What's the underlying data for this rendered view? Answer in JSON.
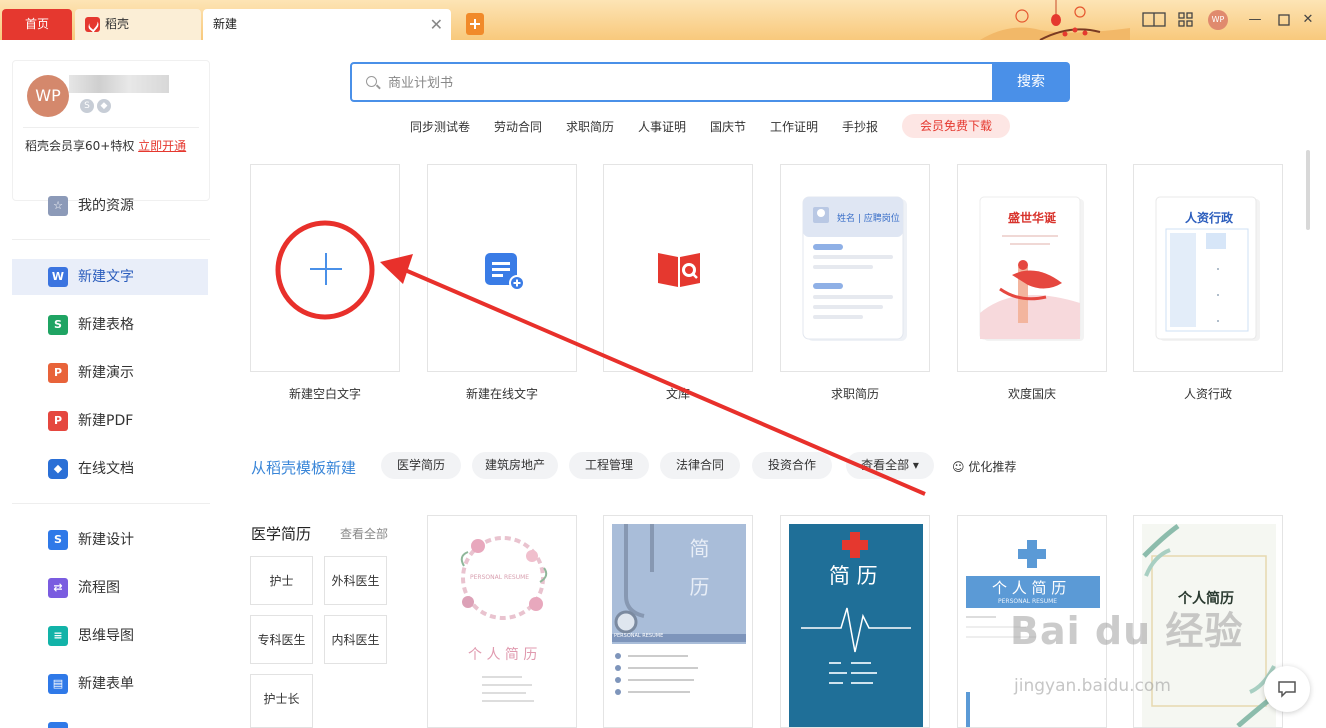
{
  "tabs": {
    "home": "首页",
    "daoke": "稻壳",
    "new": "新建"
  },
  "window": {
    "avatar_text": "WP"
  },
  "profile": {
    "avatar_text": "WP",
    "vip_text": "稻壳会员享60+特权",
    "vip_link": "立即开通"
  },
  "sidebar": {
    "resources": "我的资源",
    "items": [
      "新建文字",
      "新建表格",
      "新建演示",
      "新建PDF",
      "在线文档"
    ],
    "items2": [
      "新建设计",
      "流程图",
      "思维导图",
      "新建表单"
    ]
  },
  "search": {
    "placeholder": "商业计划书",
    "button": "搜索"
  },
  "hot_tags": [
    "同步测试卷",
    "劳动合同",
    "求职简历",
    "人事证明",
    "国庆节",
    "工作证明",
    "手抄报"
  ],
  "hot_vip": "会员免费下载",
  "cards": [
    "新建空白文字",
    "新建在线文字",
    "文库",
    "求职简历",
    "欢度国庆",
    "人资行政"
  ],
  "card_text": {
    "resume_top": "姓名 | 应聘岗位",
    "festival": "盛世华诞",
    "hr": "人资行政"
  },
  "template_section": {
    "title": "从稻壳模板新建",
    "pills": [
      "医学简历",
      "建筑房地产",
      "工程管理",
      "法律合同",
      "投资合作",
      "查看全部 ▾"
    ],
    "recommend": "优化推荐"
  },
  "category": {
    "title": "医学简历",
    "view_all": "查看全部",
    "buttons": [
      "护士",
      "外科医生",
      "专科医生",
      "内科医生",
      "护士长"
    ]
  },
  "templates": {
    "t1": "个 人 简 历",
    "t1_sub": "PERSONAL RESUME",
    "t2": "简 历",
    "t2_sub": "PERSONAL RESUME",
    "t3": "简 历",
    "t4": "个 人 简 历",
    "t4_sub": "PERSONAL RESUME",
    "t5": "个人简历"
  },
  "watermark": {
    "main": "Bai du 经验",
    "sub": "jingyan.baidu.com"
  },
  "colors": {
    "accent": "#4a90e8",
    "brand_red": "#e5382f",
    "titlebar": "#f8c97c"
  }
}
